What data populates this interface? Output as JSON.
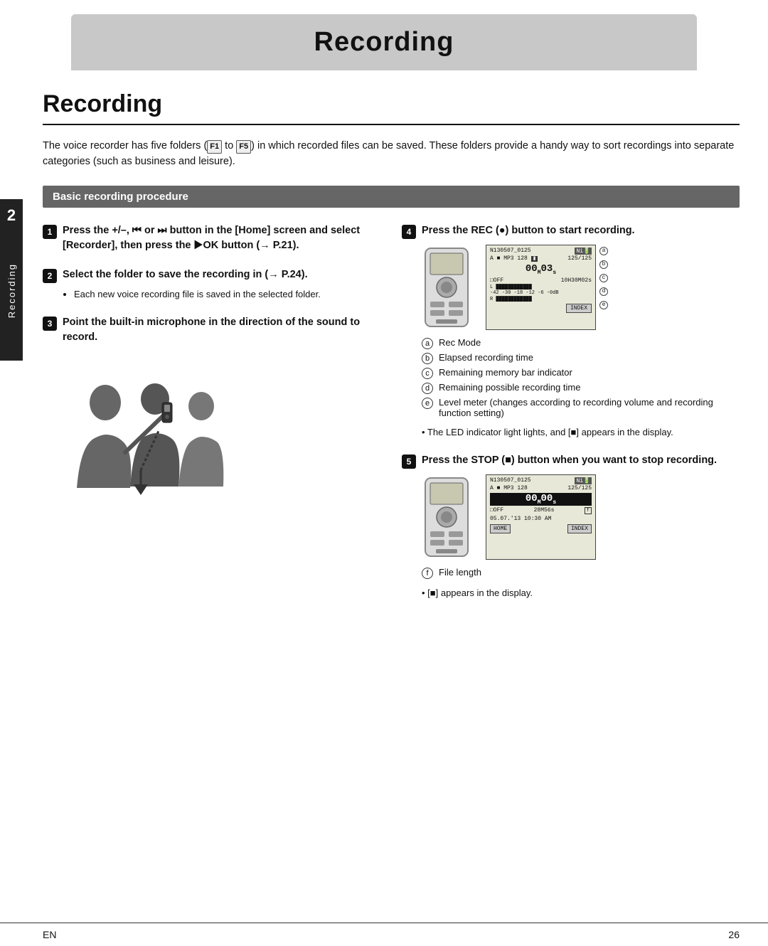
{
  "header": {
    "title": "Recording"
  },
  "section": {
    "title": "Recording",
    "intro": "The voice recorder has five folders (📁 to 📁) in which recorded files can be saved. These folders provide a handy way to sort recordings into separate categories (such as business and leisure).",
    "intro_plain": "The voice recorder has five folders (  to  ) in which recorded files can be saved. These folders provide a handy way to sort recordings into separate categories (such as business and leisure).",
    "subsection": "Basic recording procedure"
  },
  "steps": [
    {
      "num": "1",
      "text": "Press the +/–, ⏮ or ⏭ button in the [Home] screen and select [Recorder], then press the ▶OK button (→ P.21).",
      "subtext": ""
    },
    {
      "num": "2",
      "text": "Select the folder to save the recording in (→ P.24).",
      "subtext": "Each new voice recording file is saved in the selected folder."
    },
    {
      "num": "3",
      "text": "Point the built-in microphone in the direction of the sound to record.",
      "subtext": ""
    },
    {
      "num": "4",
      "text": "Press the REC (●) button to start recording.",
      "subtext": ""
    },
    {
      "num": "5",
      "text": "Press the STOP (■) button when you want to stop recording.",
      "subtext": ""
    }
  ],
  "screen1": {
    "line1_left": "N130507_0125",
    "line1_right": "Ni",
    "line2_left": "A  MP3 128",
    "line2_right": "125/125",
    "time": "00ₘ03s",
    "woff": "LOFF",
    "duration": "10H30M02s",
    "levels": "L         ",
    "db_labels": "-42  -30  -18  -12   -6  -0dB",
    "index_btn": "INDEX"
  },
  "screen2": {
    "line1_left": "N130507_0125",
    "line1_right": "Ni",
    "line2_left": "A  MP3 128",
    "line2_right": "125/125",
    "time": "00ₘ00s",
    "woff": "LOFF",
    "duration": "28M56s",
    "date": "05.07.'13 10:30 AM",
    "home_btn": "HOME",
    "index_btn": "INDEX"
  },
  "labels_step4": [
    {
      "letter": "a",
      "text": "Rec Mode"
    },
    {
      "letter": "b",
      "text": "Elapsed recording time"
    },
    {
      "letter": "c",
      "text": "Remaining memory bar indicator"
    },
    {
      "letter": "d",
      "text": "Remaining possible recording time"
    },
    {
      "letter": "e",
      "text": "Level meter (changes according to recording volume and recording function setting)"
    }
  ],
  "notes_step4": [
    "The LED indicator light lights, and [■] appears in the display."
  ],
  "labels_step5": [
    {
      "letter": "f",
      "text": "File length"
    }
  ],
  "notes_step5": [
    "[■] appears in the display."
  ],
  "footer": {
    "lang": "EN",
    "page": "26"
  },
  "side_tab": {
    "number": "2",
    "text": "Recording"
  }
}
